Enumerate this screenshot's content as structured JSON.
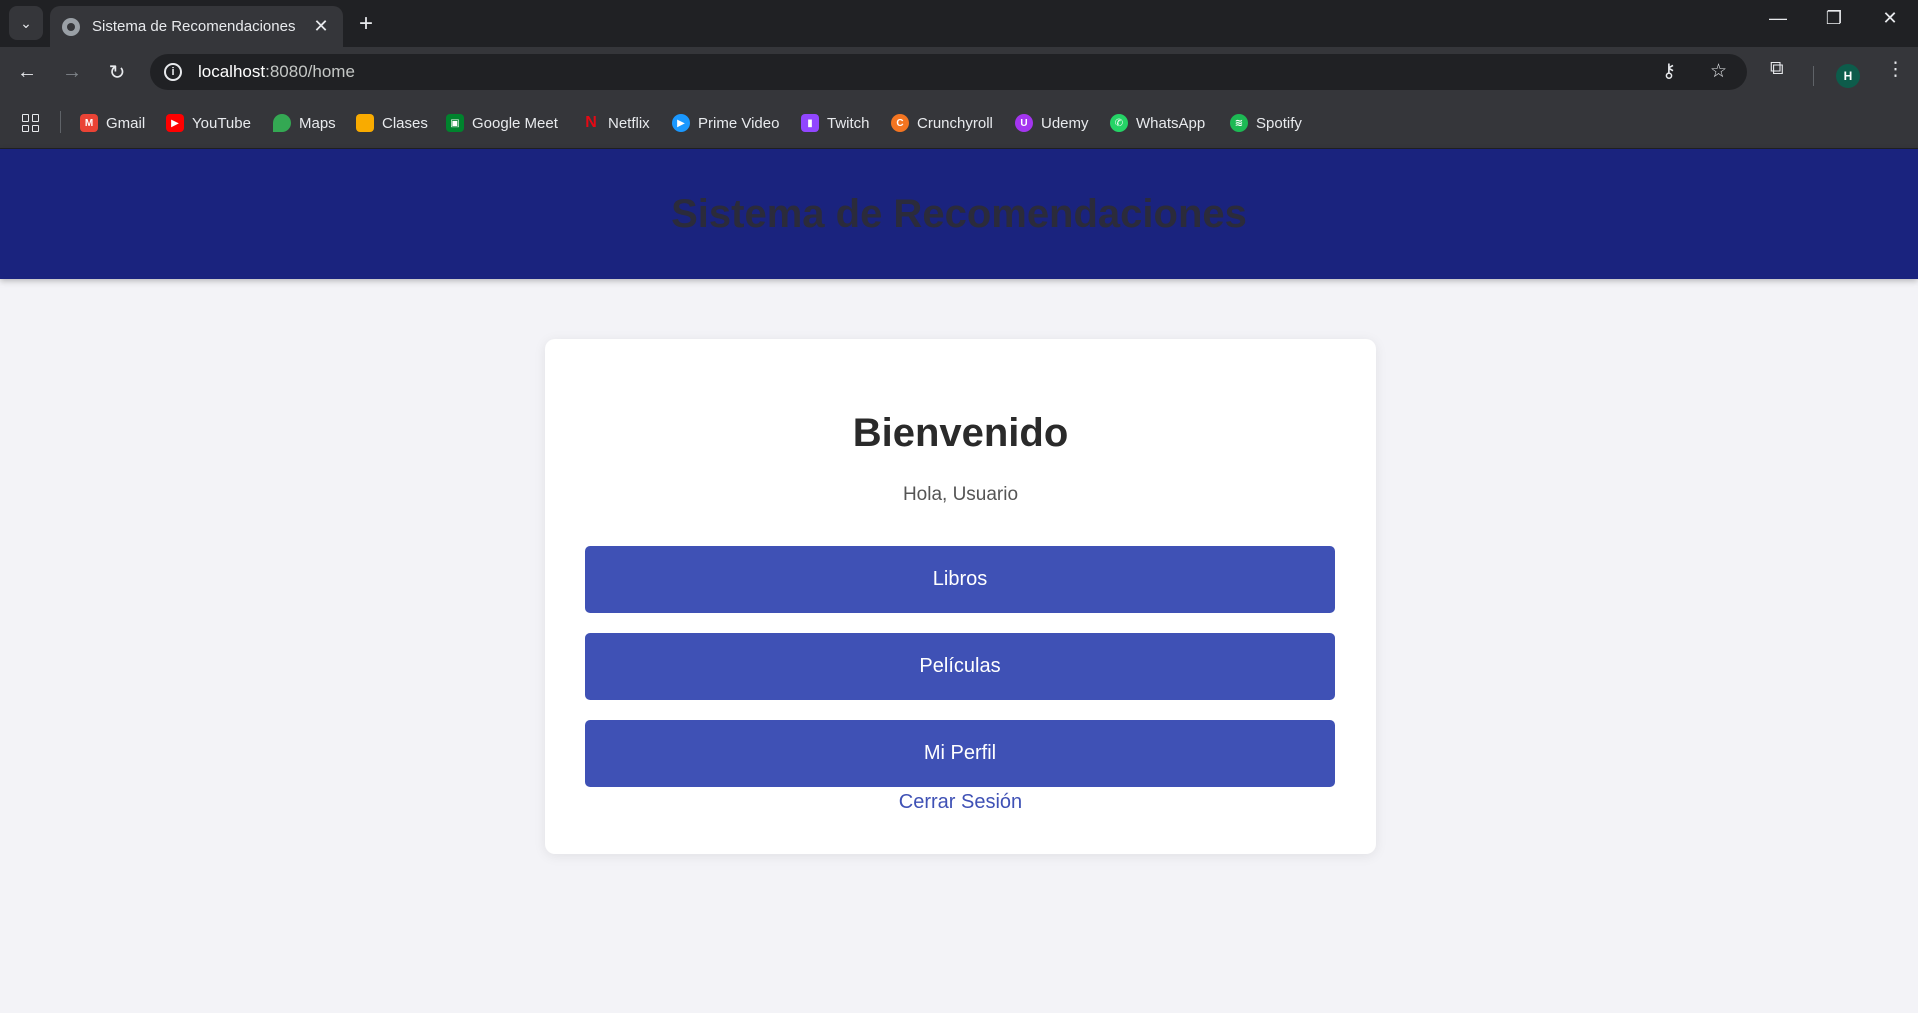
{
  "browser": {
    "tab_title": "Sistema de Recomendaciones",
    "url_host": "localhost",
    "url_path": ":8080/home",
    "profile_initial": "H",
    "bookmarks": [
      {
        "label": "Gmail",
        "icon": "gmail-icon",
        "color": "#ea4335",
        "glyph": "M"
      },
      {
        "label": "YouTube",
        "icon": "youtube-icon",
        "color": "#ff0000",
        "glyph": "▶"
      },
      {
        "label": "Maps",
        "icon": "maps-icon",
        "color": "#34a853",
        "glyph": "●"
      },
      {
        "label": "Clases",
        "icon": "classroom-icon",
        "color": "#f9ab00",
        "glyph": "■"
      },
      {
        "label": "Google Meet",
        "icon": "meet-icon",
        "color": "#00832d",
        "glyph": "▣"
      },
      {
        "label": "Netflix",
        "icon": "netflix-icon",
        "color": "#e50914",
        "glyph": "N"
      },
      {
        "label": "Prime Video",
        "icon": "prime-video-icon",
        "color": "#1a98ff",
        "glyph": "▶"
      },
      {
        "label": "Twitch",
        "icon": "twitch-icon",
        "color": "#9146ff",
        "glyph": "▮"
      },
      {
        "label": "Crunchyroll",
        "icon": "crunchyroll-icon",
        "color": "#f47521",
        "glyph": "C"
      },
      {
        "label": "Udemy",
        "icon": "udemy-icon",
        "color": "#a435f0",
        "glyph": "U"
      },
      {
        "label": "WhatsApp",
        "icon": "whatsapp-icon",
        "color": "#25d366",
        "glyph": "✆"
      },
      {
        "label": "Spotify",
        "icon": "spotify-icon",
        "color": "#1db954",
        "glyph": "≋"
      }
    ]
  },
  "page": {
    "header_title": "Sistema de Recomendaciones",
    "welcome_title": "Bienvenido",
    "greeting": "Hola, Usuario",
    "buttons": {
      "books": "Libros",
      "movies": "Películas",
      "profile": "Mi Perfil"
    },
    "logout": "Cerrar Sesión"
  },
  "colors": {
    "header_bg": "#1a237e",
    "button_bg": "#3f51b5",
    "page_bg": "#f3f3f7"
  }
}
